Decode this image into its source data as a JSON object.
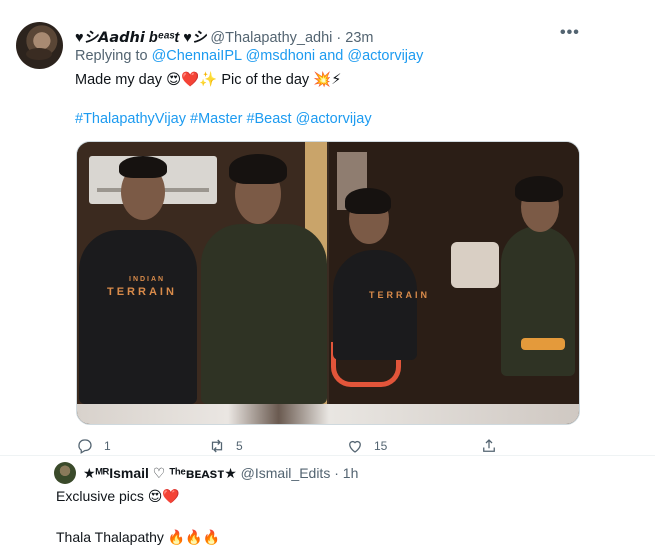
{
  "tweet": {
    "display_name": "♥シ𝘼𝙖𝙙𝙝𝙞 bᵉᵃˢt ♥シ",
    "handle": "@Thalapathy_adhi",
    "separator": "·",
    "time": "23m",
    "more_label": "•••",
    "replying_prefix": "Replying to ",
    "replying_user1": "@ChennaiIPL",
    "replying_user2": "@msdhoni",
    "replying_and": " and ",
    "replying_user3": "@actorvijay",
    "text": "Made my day 😍❤️✨ Pic of the day 💥⚡",
    "hashtag1": "#ThalapathyVijay",
    "hashtag2": "#Master",
    "hashtag3": "#Beast",
    "mention": "@actorvijay",
    "media_shirt_text": "TERRAIN",
    "media_shirt_small": "INDIAN",
    "actions": {
      "reply_count": "1",
      "retweet_count": "5",
      "like_count": "15"
    }
  },
  "reply": {
    "display_name": "★ᴹᴿIsmail ♡ ᵀʰᵉʙᴇᴀsᴛ★",
    "handle": "@Ismail_Edits",
    "separator": "·",
    "time": "1h",
    "line1": "Exclusive pics 😍❤️",
    "line2": "Thala Thalapathy 🔥🔥🔥"
  },
  "colors": {
    "link_blue": "#1d9bf0",
    "muted_gray": "#536471",
    "text_dark": "#0f1419"
  },
  "icons": [
    "reply-icon",
    "retweet-icon",
    "like-icon",
    "share-icon",
    "more-icon"
  ]
}
